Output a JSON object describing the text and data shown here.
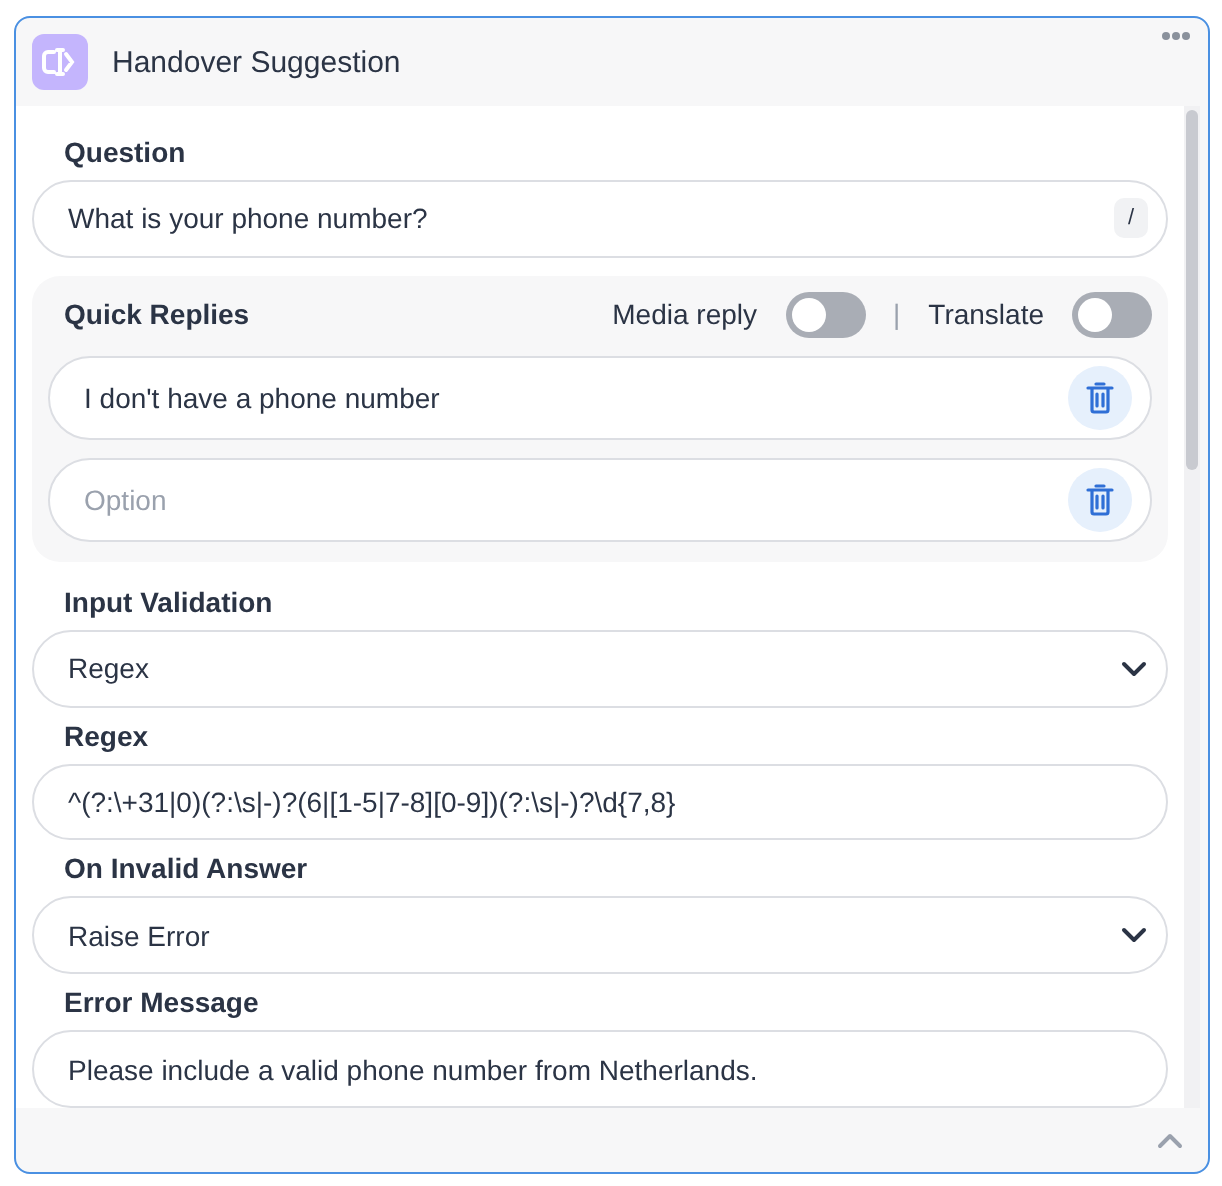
{
  "header": {
    "title": "Handover Suggestion"
  },
  "question": {
    "label": "Question",
    "value": "What is your phone number?",
    "shortcut": "/"
  },
  "quick_replies": {
    "label": "Quick Replies",
    "separator": "|",
    "toggles": [
      {
        "label": "Media reply",
        "on": false
      },
      {
        "label": "Translate",
        "on": false
      }
    ],
    "options": [
      {
        "value": "I don't have a phone number"
      },
      {
        "placeholder": "Option"
      }
    ]
  },
  "fields": [
    {
      "kind": "select",
      "label": "Input Validation",
      "value": "Regex"
    },
    {
      "kind": "text",
      "label": "Regex",
      "value": "^(?:\\+31|0)(?:\\s|-)?(6|[1-5|7-8][0-9])(?:\\s|-)?\\d{7,8}"
    },
    {
      "kind": "select",
      "label": "On Invalid Answer",
      "value": "Raise Error"
    },
    {
      "kind": "text",
      "label": "Error Message",
      "value": "Please include a valid phone number from Netherlands."
    }
  ]
}
